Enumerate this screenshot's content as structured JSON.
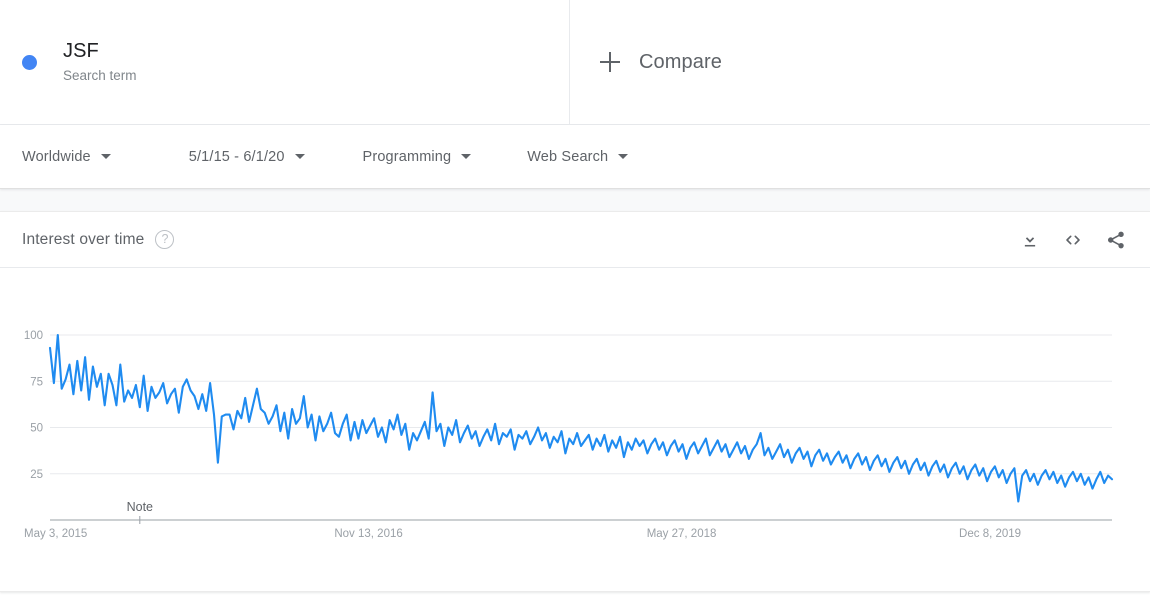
{
  "term": {
    "name": "JSF",
    "type_label": "Search term",
    "dot_color": "#4285f4"
  },
  "compare": {
    "label": "Compare",
    "icon": "plus-icon"
  },
  "filters": {
    "geo": "Worldwide",
    "time": "5/1/15 - 6/1/20",
    "category": "Programming",
    "search_type": "Web Search"
  },
  "card": {
    "title": "Interest over time",
    "help_icon": "help-circle-icon",
    "actions": [
      {
        "name": "download-icon",
        "label": "Download"
      },
      {
        "name": "embed-icon",
        "label": "Embed"
      },
      {
        "name": "share-icon",
        "label": "Share"
      }
    ]
  },
  "chart_data": {
    "type": "line",
    "title": "Interest over time",
    "xlabel": "",
    "ylabel": "",
    "ylim": [
      0,
      100
    ],
    "yticks": [
      25,
      50,
      75,
      100
    ],
    "grid": true,
    "legend": false,
    "line_color": "#1f8bf0",
    "xtick_labels": [
      "May 3, 2015",
      "Nov 13, 2016",
      "May 27, 2018",
      "Dec 8, 2019"
    ],
    "xtick_positions": [
      0,
      80,
      160,
      240
    ],
    "annotations": [
      {
        "label": "Note",
        "x_index": 23
      }
    ],
    "series": [
      {
        "name": "JSF",
        "values": [
          93,
          74,
          100,
          71,
          76,
          84,
          68,
          86,
          70,
          88,
          65,
          83,
          72,
          79,
          62,
          79,
          73,
          62,
          84,
          64,
          70,
          66,
          73,
          61,
          78,
          59,
          72,
          66,
          69,
          74,
          63,
          68,
          71,
          58,
          72,
          76,
          70,
          67,
          60,
          68,
          59,
          74,
          57,
          31,
          56,
          57,
          57,
          49,
          59,
          55,
          66,
          53,
          62,
          71,
          60,
          58,
          52,
          56,
          62,
          48,
          58,
          44,
          60,
          52,
          55,
          67,
          50,
          57,
          43,
          56,
          48,
          52,
          58,
          47,
          45,
          52,
          57,
          43,
          53,
          44,
          54,
          47,
          51,
          55,
          45,
          50,
          42,
          54,
          49,
          57,
          46,
          52,
          38,
          47,
          43,
          48,
          53,
          44,
          69,
          48,
          52,
          40,
          50,
          46,
          54,
          42,
          47,
          51,
          44,
          48,
          40,
          45,
          49,
          43,
          52,
          41,
          47,
          45,
          49,
          38,
          46,
          44,
          48,
          41,
          45,
          50,
          43,
          47,
          39,
          45,
          42,
          48,
          36,
          44,
          41,
          47,
          40,
          43,
          46,
          38,
          44,
          40,
          46,
          37,
          43,
          39,
          45,
          34,
          42,
          38,
          44,
          40,
          43,
          36,
          41,
          44,
          38,
          42,
          35,
          40,
          43,
          37,
          41,
          33,
          39,
          42,
          36,
          40,
          44,
          35,
          39,
          43,
          37,
          41,
          34,
          38,
          42,
          36,
          40,
          33,
          38,
          41,
          47,
          35,
          39,
          33,
          37,
          41,
          34,
          38,
          31,
          36,
          39,
          33,
          37,
          29,
          35,
          38,
          32,
          36,
          30,
          34,
          37,
          31,
          35,
          28,
          33,
          36,
          30,
          34,
          27,
          32,
          35,
          29,
          33,
          26,
          31,
          34,
          28,
          32,
          25,
          30,
          33,
          27,
          31,
          24,
          29,
          32,
          26,
          30,
          23,
          28,
          31,
          25,
          29,
          22,
          27,
          30,
          24,
          28,
          21,
          26,
          29,
          23,
          27,
          20,
          25,
          28,
          10,
          24,
          27,
          21,
          25,
          19,
          24,
          27,
          22,
          26,
          20,
          24,
          18,
          23,
          26,
          21,
          25,
          19,
          23,
          17,
          22,
          26,
          20,
          24,
          22
        ]
      }
    ]
  }
}
